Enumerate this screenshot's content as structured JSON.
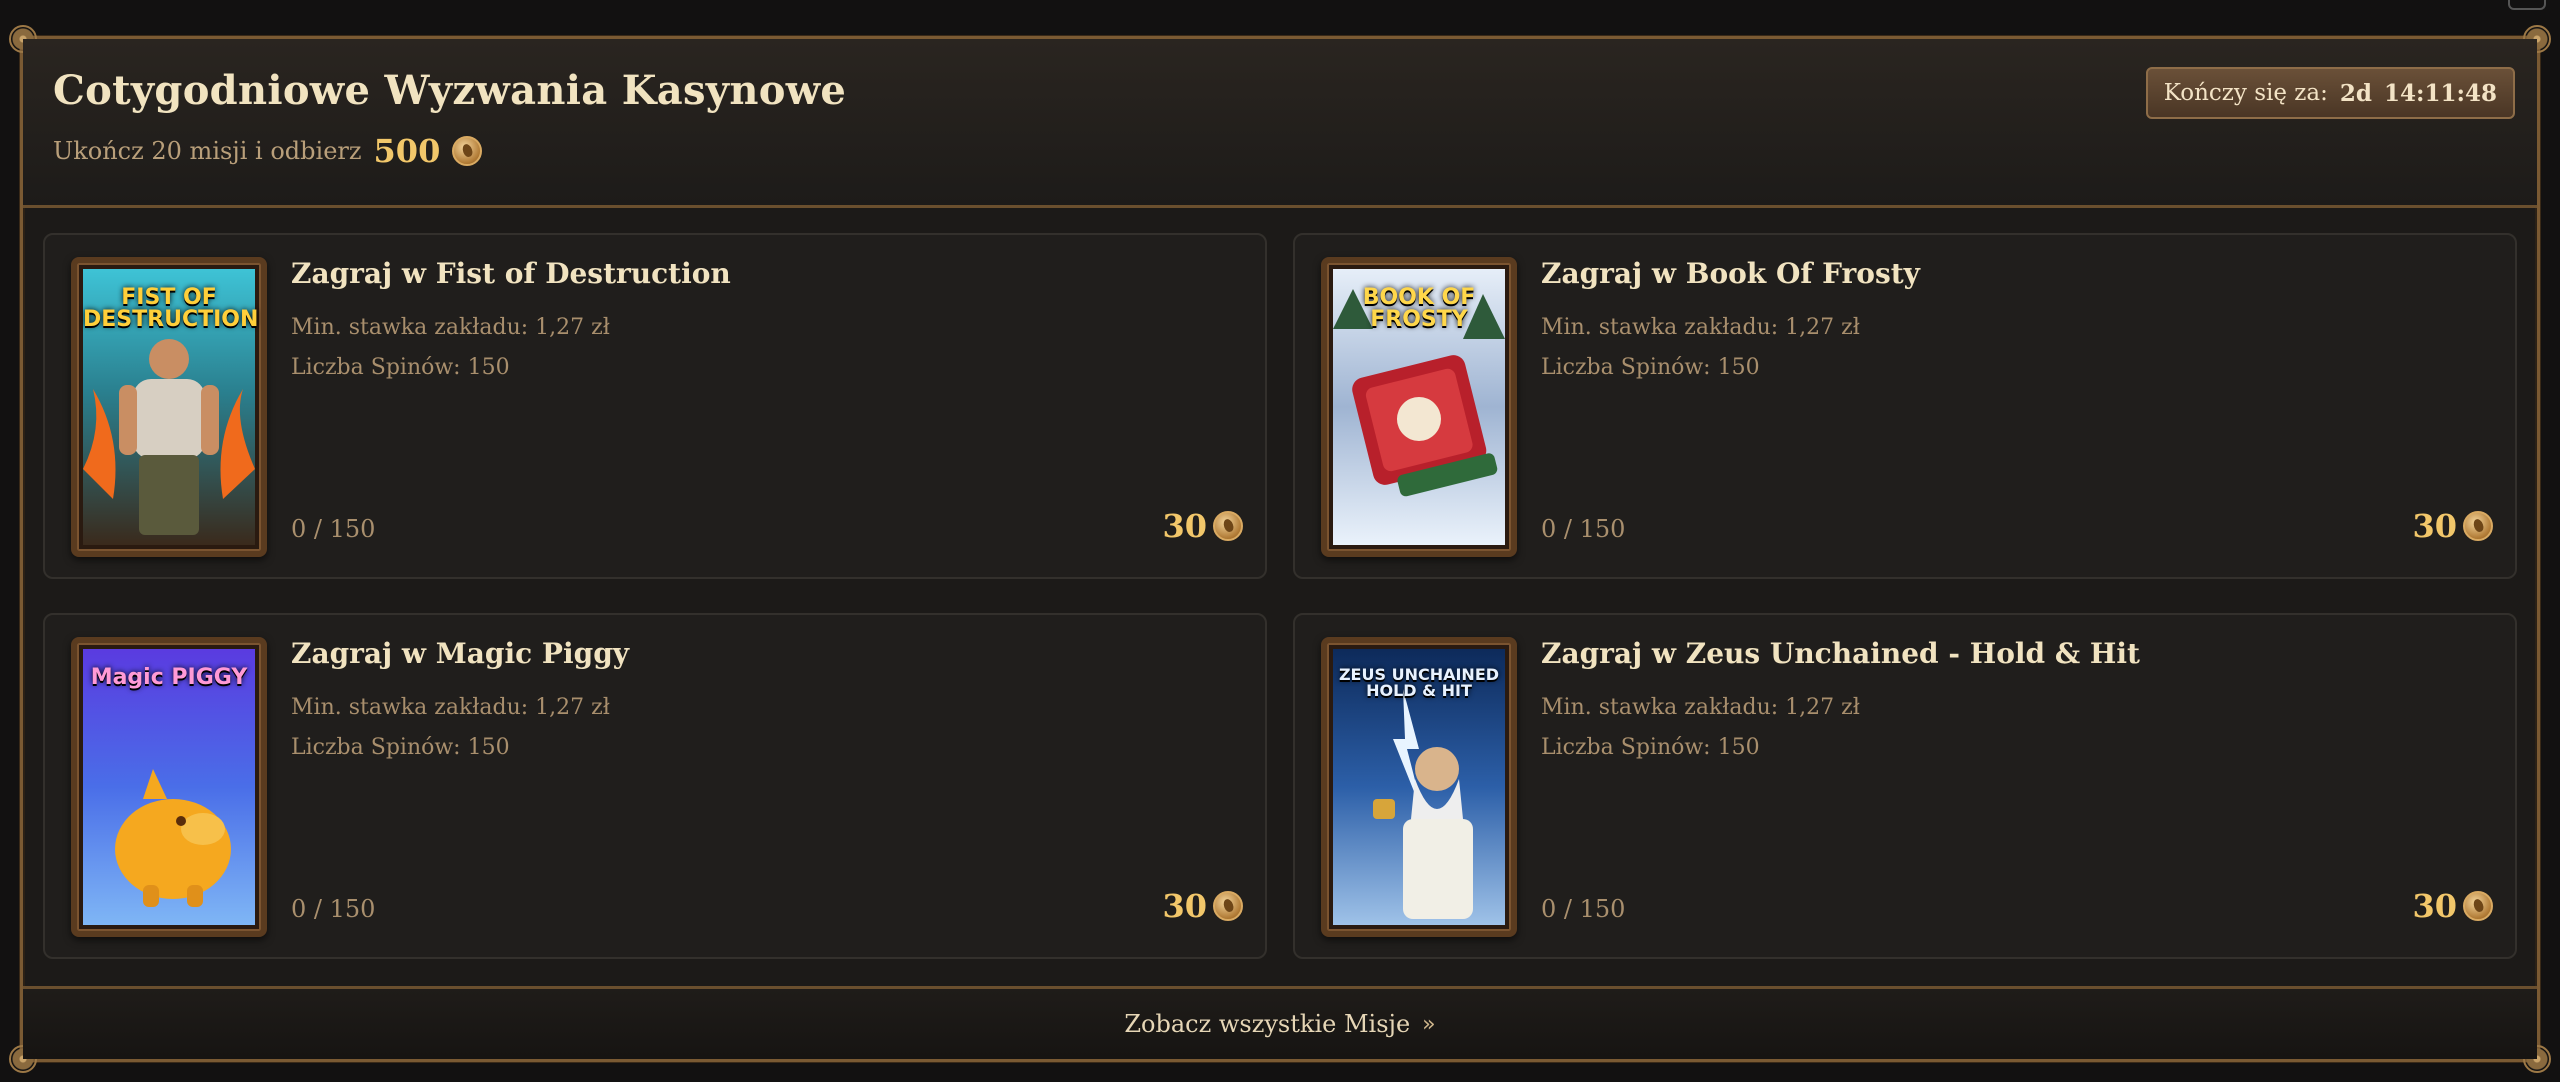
{
  "header": {
    "title": "Cotygodniowe Wyzwania Kasynowe",
    "subtitle": "Ukończ 20 misji i odbierz",
    "total_reward": "500",
    "timer_label": "Kończy się za:",
    "timer_days": "2d",
    "timer_time": "14:11:48"
  },
  "missions": [
    {
      "title": "Zagraj w Fist of Destruction",
      "min_bet": "Min. stawka zakładu: 1,27 zł",
      "spins": "Liczba Spinów: 150",
      "progress": "0 / 150",
      "reward": "30",
      "thumb_text": "FIST OF DESTRUCTION"
    },
    {
      "title": "Zagraj w Book Of Frosty",
      "min_bet": "Min. stawka zakładu: 1,27 zł",
      "spins": "Liczba Spinów: 150",
      "progress": "0 / 150",
      "reward": "30",
      "thumb_text": "BOOK OF FROSTY"
    },
    {
      "title": "Zagraj w Magic Piggy",
      "min_bet": "Min. stawka zakładu: 1,27 zł",
      "spins": "Liczba Spinów: 150",
      "progress": "0 / 150",
      "reward": "30",
      "thumb_text": "Magic PIGGY"
    },
    {
      "title": "Zagraj w Zeus Unchained - Hold & Hit",
      "min_bet": "Min. stawka zakładu: 1,27 zł",
      "spins": "Liczba Spinów: 150",
      "progress": "0 / 150",
      "reward": "30",
      "thumb_text": "ZEUS UNCHAINED HOLD & HIT"
    }
  ],
  "footer": {
    "link_label": "Zobacz wszystkie Misje"
  },
  "icons": {
    "coin": "coin-icon",
    "chevron": "chevron-right-icon"
  },
  "colors": {
    "accent": "#f2c76a",
    "border": "#7a5a33",
    "background": "#1c1a18"
  }
}
